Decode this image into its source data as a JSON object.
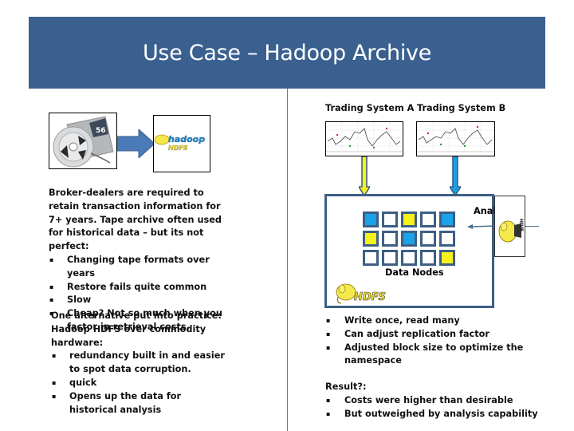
{
  "title": "Use Case – Hadoop Archive",
  "left": {
    "tape_image": "tape-reel-icon",
    "hadoop_logo": {
      "icon": "hadoop-logo-icon",
      "text": "hadoop",
      "subtext": "HDFS"
    },
    "intro": "Broker-dealers are required to retain transaction information for 7+ years. Tape archive often used for historical data – but its not perfect:",
    "problems": [
      "Changing tape formats over years",
      "Restore fails quite common",
      "Slow",
      "Cheap? Not so much when you factor in retrieval costs."
    ],
    "alternative_intro": "One alternative put into practice: Hadoop HDFS over commodity hardware:",
    "benefits": [
      "redundancy built in and easier to spot data corruption.",
      "quick",
      "Opens up the data for historical analysis"
    ]
  },
  "right": {
    "trading_systems": [
      {
        "label": "Trading System A",
        "arrow_color": "#f5f01e"
      },
      {
        "label": "Trading System B",
        "arrow_color": "#1b9ee0"
      }
    ],
    "data_nodes_label": "Data Nodes",
    "data_nodes_grid": [
      [
        "blue",
        "empty",
        "yellow",
        "empty",
        "blue"
      ],
      [
        "yellow",
        "empty",
        "blue",
        "empty",
        "empty"
      ],
      [
        "empty",
        "empty",
        "empty",
        "empty",
        "yellow"
      ]
    ],
    "hdfs_logo_text": "HDFS",
    "analysis_label": "Analysis",
    "features": [
      "Write once, read many",
      "Can adjust replication factor",
      "Adjusted block size to optimize the namespace"
    ],
    "result_label": "Result?:",
    "results": [
      "Costs were higher than desirable",
      "But outweighed by analysis capability"
    ]
  },
  "colors": {
    "title_bar": "#3a6090",
    "node_border": "#3d5f86",
    "node_blue": "#1aa3e8",
    "node_yellow": "#f7f01a",
    "hadoop_yellow": "#f4e84a"
  }
}
